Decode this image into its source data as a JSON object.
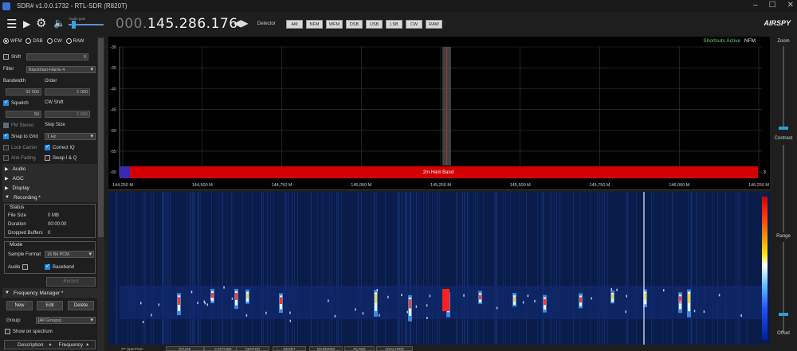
{
  "window": {
    "title": "SDR# v1.0.0.1732 - RTL-SDR (R820T)",
    "controls": [
      "–",
      "☐",
      "✕"
    ]
  },
  "toolbar": {
    "icons": [
      "menu-icon",
      "play-icon",
      "gear-icon",
      "speaker-icon"
    ],
    "volume_label": "Audio gain",
    "frequency_prefix": "000.",
    "frequency_main": "145.286.176",
    "detector_label": "Detector",
    "mode_buttons": [
      "AM",
      "NFM",
      "WFM",
      "DSB",
      "USB",
      "LSB",
      "CW",
      "RAW"
    ],
    "brand": "AIRSPY"
  },
  "radio_panel": {
    "modes": [
      "WFM",
      "DSB",
      "CW",
      "RAW"
    ],
    "selected_mode": "WFM",
    "shift_label": "Shift",
    "shift_value": "0",
    "filter_label": "Filter",
    "filter_value": "Blackman-Harris 4",
    "bandwidth_label": "Bandwidth",
    "order_label": "Order",
    "bandwidth_value": "32 000",
    "order_value": "1 000",
    "squelch_label": "Squelch",
    "cw_shift_label": "CW Shift",
    "squelch_value": "50",
    "cw_shift_value": "1 000",
    "fm_stereo_label": "FM Stereo",
    "step_size_label": "Step Size",
    "snap_to_grid_label": "Snap to Grid",
    "step_size_value": "1 Hz",
    "lock_carrier_label": "Lock Carrier",
    "correct_iq_label": "Correct IQ",
    "anti_fading_label": "Anti-Fading",
    "swap_iq_label": "Swap I & Q"
  },
  "sections": {
    "audio": "Audio",
    "agc": "AGC",
    "display": "Display",
    "recording": "Recording *",
    "freq_manager": "Frequency Manager *"
  },
  "recording": {
    "status_title": "Status",
    "file_size_label": "File Size",
    "file_size_value": "0 MB",
    "duration_label": "Duration",
    "duration_value": "00:00:00",
    "dropped_label": "Dropped Buffers",
    "dropped_value": "0",
    "mode_title": "Mode",
    "sample_format_label": "Sample Format",
    "sample_format_value": "16 Bit PCM",
    "audio_label": "Audio",
    "baseband_label": "Baseband",
    "record_button": "Record"
  },
  "freq_manager": {
    "new_button": "New",
    "edit_button": "Edit",
    "delete_button": "Delete",
    "group_label": "Group:",
    "group_value": "[All Groups]",
    "show_on_spectrum_label": "Show on spectrum",
    "col_description": "Description",
    "col_frequency": "Frequency"
  },
  "spectrum": {
    "shortcuts_text": "Shortcuts Active",
    "mode_text": "NFM",
    "y_ticks": [
      "-30",
      "-35",
      "-40",
      "-45",
      "-50",
      "-55",
      "-60"
    ],
    "x_ticks": [
      "144,250 M",
      "144,500 M",
      "144,750 M",
      "145,000 M",
      "145,250 M",
      "145,500 M",
      "145,750 M",
      "146,000 M",
      "146,250 M"
    ],
    "band_label": "2m Ham Band",
    "band_end_marker": "3",
    "band_color": "#d40000",
    "band_start_color": "#3a2ab0"
  },
  "bottom_tabs": [
    "FF SpecTrum",
    "PAUSE",
    "CAPTURE",
    "CENTER",
    "RESET",
    "MARKERS",
    "FILTER",
    "ANALYZER"
  ],
  "right_column": {
    "zoom_label": "Zoom",
    "contrast_label": "Contrast",
    "range_label": "Range",
    "offset_label": "Offset"
  },
  "colors": {
    "accent": "#1e88e5",
    "shortcuts": "#6cd06c",
    "waterfall_bg": "#0a1c4a"
  }
}
